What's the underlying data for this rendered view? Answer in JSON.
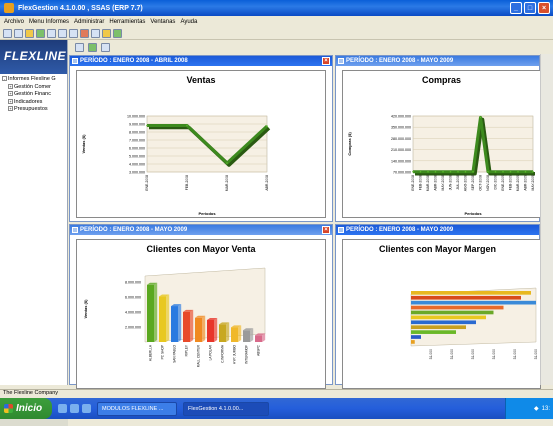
{
  "window": {
    "title": "FlexGestion 4.1.0.00 , SSAS (ERP 7.7)",
    "min": "_",
    "max": "□",
    "close": "×"
  },
  "menu": [
    "Archivo",
    "Menu Informes",
    "Administrar",
    "Herramientas",
    "Ventanas",
    "Ayuda"
  ],
  "logo": "FLEXLINE",
  "tree": [
    {
      "label": "Informes Flexline G",
      "indent": 0,
      "expander": "-"
    },
    {
      "label": "Gestión Comer",
      "indent": 1,
      "expander": "+"
    },
    {
      "label": "Gestión Financ",
      "indent": 1,
      "expander": "+"
    },
    {
      "label": "Indicadores",
      "indent": 1,
      "expander": "+"
    },
    {
      "label": "Presupuestos",
      "indent": 1,
      "expander": "+"
    }
  ],
  "panels": [
    {
      "period": "PERÍODO : ENERO 2008 - ABRIL 2008",
      "close": "×"
    },
    {
      "period": "PERÍODO : ENERO 2008 - MAYO 2009"
    },
    {
      "period": "PERÍODO : ENERO 2008 - MAYO 2009",
      "close": "×"
    },
    {
      "period": "PERÍODO : ENERO 2008 - MAYO 2009"
    }
  ],
  "status": "The Flexline Company",
  "taskbar": {
    "start": "Inicio",
    "tasks": [
      "MODULOS FLEXLINE ...",
      "FlexGestion 4.1.0.00..."
    ],
    "clock": "13:"
  },
  "colors": {
    "titlebar": "#0a5fd8",
    "panel_title": "#3a7ae0",
    "green_line": "#3d8a1e"
  },
  "chart_data": [
    {
      "type": "line",
      "title": "Ventas",
      "ylabel": "Ventas ($)",
      "xlabel": "Periodos",
      "categories": [
        "ENE-2008",
        "FEB-2008",
        "MAR-2008",
        "ABR-2008"
      ],
      "values": [
        8300000,
        8300000,
        1600000,
        8200000
      ],
      "yticks": [
        "10.000.000",
        "9.000.000",
        "8.000.000",
        "7.000.000",
        "6.000.000",
        "5.000.000",
        "4.000.000",
        "3.000.000"
      ],
      "ylim": [
        0,
        10000000
      ]
    },
    {
      "type": "line",
      "title": "Compras",
      "ylabel": "Compras ($)",
      "xlabel": "Periodos",
      "categories": [
        "ENE-2008",
        "FEB-2008",
        "MAR-2008",
        "ABR-2008",
        "MAY-2008",
        "JUN-2008",
        "JUL-2008",
        "AGO-2008",
        "SEP-2008",
        "OCT-2008",
        "NOV-2008",
        "DIC-2008",
        "ENE-2009",
        "FEB-2009",
        "MAR-2009",
        "ABR-2009",
        "MAY-2009"
      ],
      "values": [
        2000000,
        2000000,
        2000000,
        2000000,
        2000000,
        2000000,
        2000000,
        2000000,
        2000000,
        410000000,
        2000000,
        2000000,
        2000000,
        2000000,
        2000000,
        2000000,
        2000000
      ],
      "yticks": [
        "420.000.000",
        "350.000.000",
        "280.000.000",
        "210.000.000",
        "140.000.000",
        "70.000.000"
      ],
      "ylim": [
        0,
        420000000
      ]
    },
    {
      "type": "bar",
      "title": "Clientes con Mayor Venta",
      "ylabel": "Ventas ($)",
      "categories": [
        "ALBERLLA",
        "PC SHOP",
        "SAN PABLO",
        "RIPLEY",
        "MALL CENTER",
        "LA POLAR",
        "C.INFORMA",
        "HYP. JUMBO",
        "INTERAMOF",
        "ABSPC"
      ],
      "values": [
        7800000,
        6200000,
        4900000,
        4100000,
        3300000,
        3000000,
        2400000,
        2000000,
        1600000,
        900000
      ],
      "bar_colors": [
        "#5aa820",
        "#e8c820",
        "#2a7ae0",
        "#e84a2a",
        "#f08a20",
        "#e8362a",
        "#c8a820",
        "#f0b82a",
        "#9a9a9a",
        "#d86a8a"
      ],
      "yticks": [
        "8.000.000",
        "6.000.000",
        "4.000.000",
        "2.000.000"
      ],
      "ylim": [
        0,
        9000000
      ]
    },
    {
      "type": "bar",
      "title": "Clientes con Mayor Margen",
      "orientation": "horizontal",
      "values": [
        96,
        88,
        100,
        74,
        66,
        60,
        52,
        44,
        36,
        8,
        3
      ],
      "bar_colors": [
        "#e8b820",
        "#d84a1a",
        "#3a8ad8",
        "#e86a2a",
        "#6aa828",
        "#e8c820",
        "#2a6ad0",
        "#c8a020",
        "#6ab828",
        "#2a5ac8",
        "#e8a020"
      ],
      "yticks": [
        "31.000",
        "31.000",
        "31.000",
        "31.000",
        "31.000",
        "31.000"
      ]
    }
  ]
}
